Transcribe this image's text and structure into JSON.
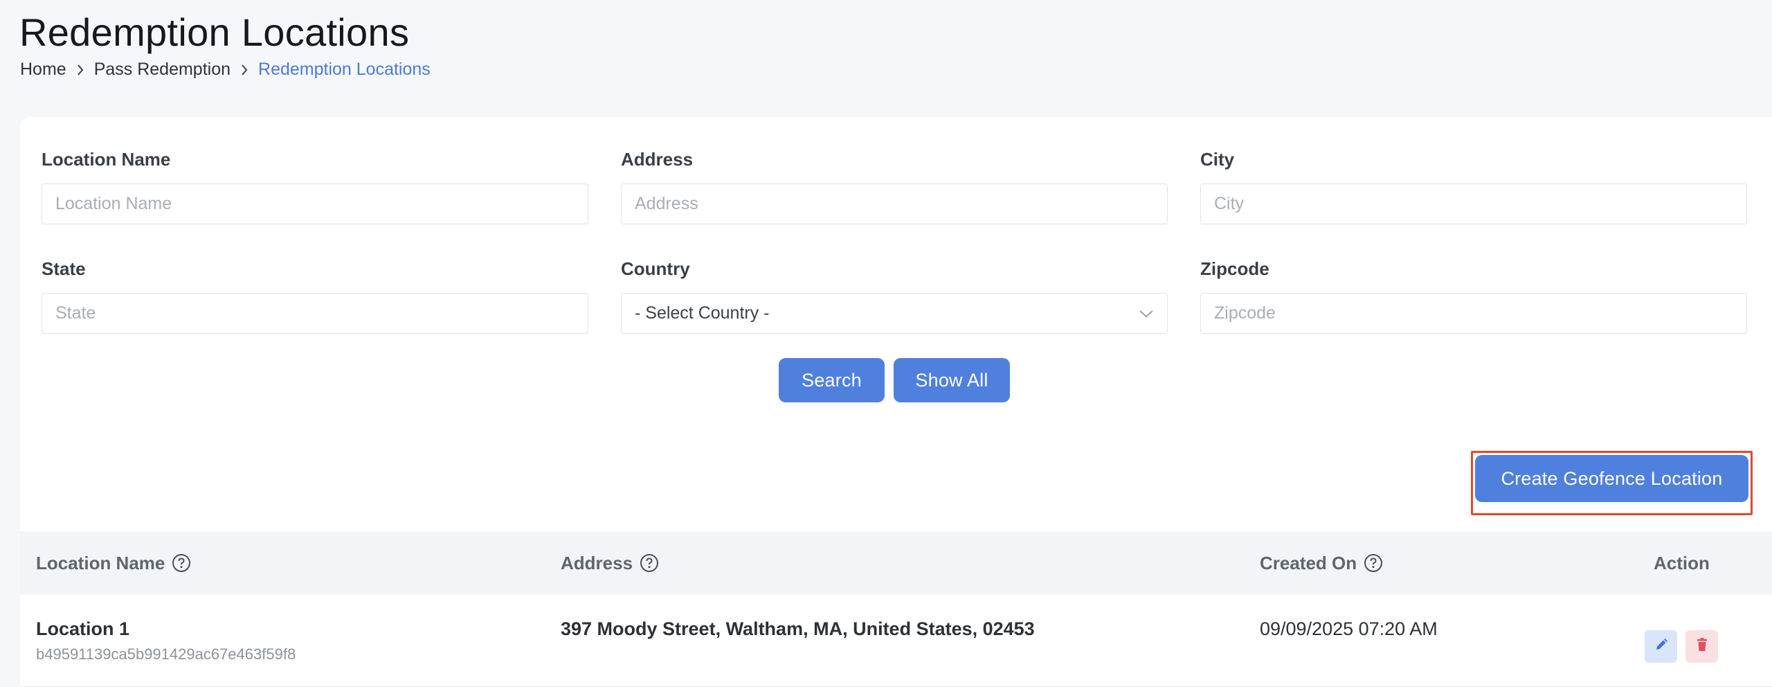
{
  "page": {
    "title": "Redemption Locations",
    "breadcrumb": [
      "Home",
      "Pass Redemption",
      "Redemption Locations"
    ]
  },
  "filters": {
    "location_name": {
      "label": "Location Name",
      "placeholder": "Location Name",
      "value": ""
    },
    "address": {
      "label": "Address",
      "placeholder": "Address",
      "value": ""
    },
    "city": {
      "label": "City",
      "placeholder": "City",
      "value": ""
    },
    "state": {
      "label": "State",
      "placeholder": "State",
      "value": ""
    },
    "country": {
      "label": "Country",
      "selected": "- Select Country -"
    },
    "zipcode": {
      "label": "Zipcode",
      "placeholder": "Zipcode",
      "value": ""
    }
  },
  "buttons": {
    "search": "Search",
    "show_all": "Show All",
    "create": "Create Geofence Location"
  },
  "table": {
    "headers": {
      "location_name": "Location Name",
      "address": "Address",
      "created_on": "Created On",
      "action": "Action"
    },
    "rows": [
      {
        "name": "Location 1",
        "id": "b49591139ca5b991429ac67e463f59f8",
        "address": "397 Moody Street, Waltham, MA, United States, 02453",
        "created_on": "09/09/2025 07:20 AM"
      }
    ]
  },
  "colors": {
    "accent": "#4f80de",
    "breadcrumb_active": "#4a7bd6",
    "highlight": "#e0492f",
    "edit_bg": "#d8e5fa",
    "delete_bg": "#fbe0e2",
    "delete_icon": "#e0525f"
  },
  "icons": {
    "breadcrumb_separator": "chevron-right-icon",
    "select_arrow": "chevron-down-icon",
    "header_help": "question-circle-icon",
    "edit": "pencil-icon",
    "delete": "trash-icon"
  }
}
